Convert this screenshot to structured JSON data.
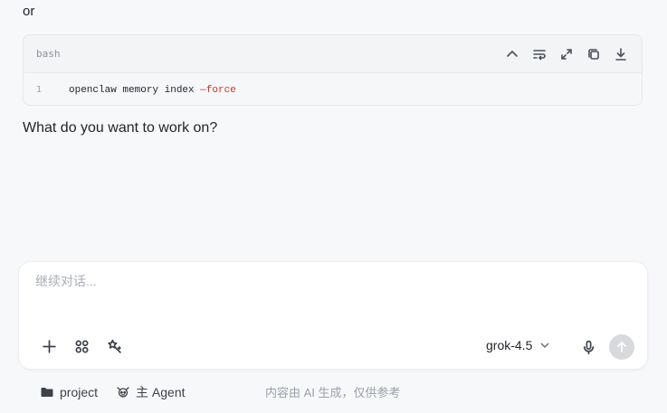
{
  "chat": {
    "or_text": "or",
    "code_block": {
      "language": "bash",
      "line_number": "1",
      "code_command": "openclaw memory index ",
      "code_flag": "—force",
      "tools": [
        "collapse-icon",
        "wrap-icon",
        "expand-icon",
        "copy-icon",
        "download-icon"
      ]
    },
    "question": "What do you want to work on?"
  },
  "composer": {
    "placeholder": "继续对话...",
    "value": "",
    "model": "grok-4.5"
  },
  "footer": {
    "project_label": "project",
    "agent_label": "主 Agent",
    "disclaimer": "内容由 AI 生成，仅供参考"
  }
}
